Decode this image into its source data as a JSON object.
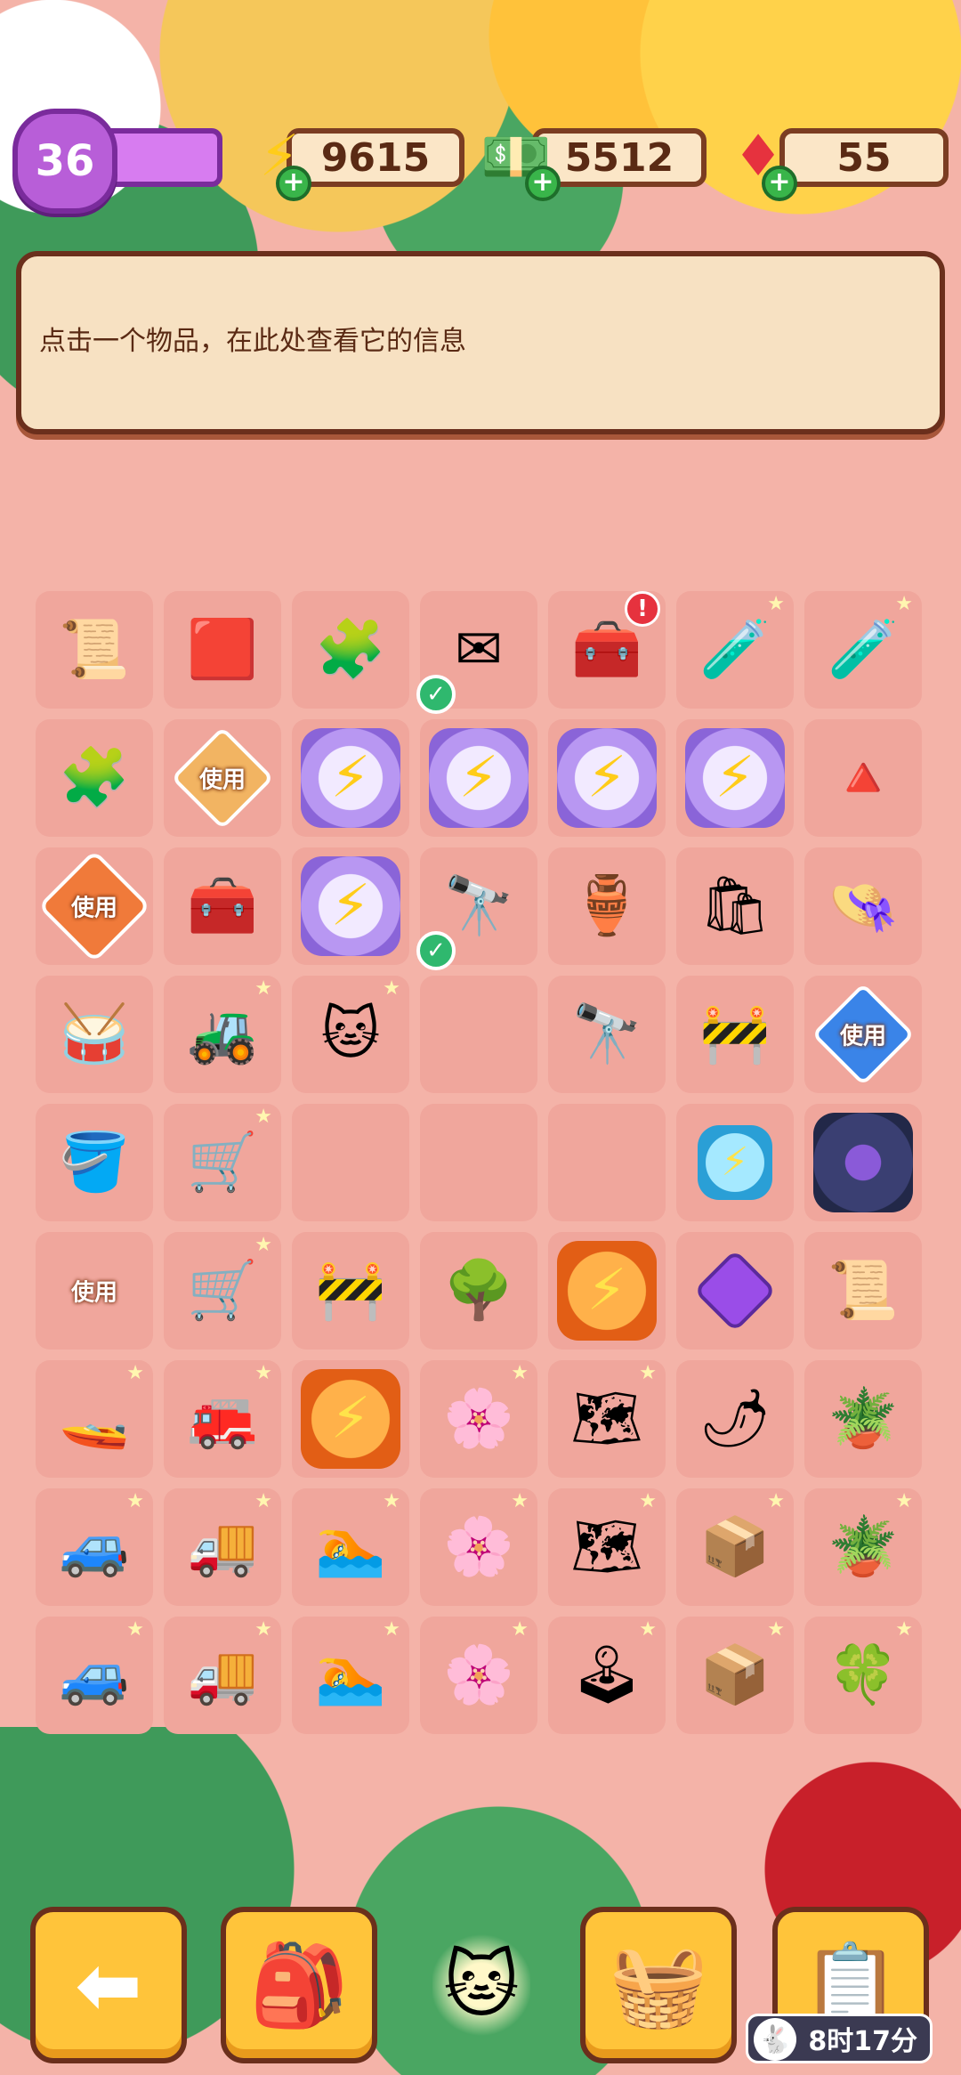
{
  "status": {
    "level": "36",
    "energy": "9615",
    "cash": "5512",
    "gems": "55"
  },
  "info_panel": {
    "text": "点击一个物品，在此处查看它的信息"
  },
  "use_label": "使用",
  "grid": [
    [
      {
        "icon": "reward-poster-icon",
        "glyph": "📜"
      },
      {
        "icon": "red-box-icon",
        "glyph": "🟥"
      },
      {
        "icon": "tape-pieces-icon",
        "glyph": "🧩"
      },
      {
        "icon": "envelope-icon",
        "glyph": "✉",
        "check": true
      },
      {
        "icon": "treasure-chest-icon",
        "glyph": "🧰",
        "alert": true
      },
      {
        "icon": "medical-kit-icon",
        "glyph": "🧪",
        "sparkle": true
      },
      {
        "icon": "medical-kit-icon",
        "glyph": "🧪",
        "sparkle": true
      }
    ],
    [
      {
        "icon": "map-piece-icon",
        "glyph": "🧩"
      },
      {
        "icon": "use-badge-beige-icon",
        "label": true
      },
      {
        "icon": "energy-orb-icon",
        "glyph": "⚡"
      },
      {
        "icon": "energy-orb-icon",
        "glyph": "⚡"
      },
      {
        "icon": "energy-orb-icon",
        "glyph": "⚡"
      },
      {
        "icon": "energy-orb-icon",
        "glyph": "⚡"
      },
      {
        "icon": "cone-stand-icon",
        "glyph": "🔺"
      }
    ],
    [
      {
        "icon": "use-badge-orange-icon",
        "label": true
      },
      {
        "icon": "toolbox-icon",
        "glyph": "🧰"
      },
      {
        "icon": "energy-orb-icon",
        "glyph": "⚡"
      },
      {
        "icon": "binoculars-icon",
        "glyph": "🔭",
        "check": true
      },
      {
        "icon": "clay-pot-icon",
        "glyph": "🏺"
      },
      {
        "icon": "bag-icon",
        "glyph": "🛍"
      },
      {
        "icon": "hat-icon",
        "glyph": "👒"
      }
    ],
    [
      {
        "icon": "drum-icon",
        "glyph": "🥁"
      },
      {
        "icon": "red-machine-icon",
        "glyph": "🚜",
        "sparkle": true
      },
      {
        "icon": "lucky-cat-icon",
        "glyph": "🐱",
        "sparkle": true
      },
      {
        "icon": "empty",
        "glyph": ""
      },
      {
        "icon": "telescope-icon",
        "glyph": "🔭"
      },
      {
        "icon": "barrier-icon",
        "glyph": "🚧"
      },
      {
        "icon": "use-badge-blue-icon",
        "label": true
      }
    ],
    [
      {
        "icon": "bucket-icon",
        "glyph": "🪣"
      },
      {
        "icon": "red-cart-icon",
        "glyph": "🛒",
        "sparkle": true
      },
      {
        "icon": "empty",
        "glyph": ""
      },
      {
        "icon": "empty",
        "glyph": ""
      },
      {
        "icon": "empty",
        "glyph": ""
      },
      {
        "icon": "energy-small-icon",
        "glyph": "⚡"
      },
      {
        "icon": "wheel-icon",
        "glyph": ""
      }
    ],
    [
      {
        "icon": "cone-use-icon",
        "label": true
      },
      {
        "icon": "white-cart-icon",
        "glyph": "🛒",
        "sparkle": true
      },
      {
        "icon": "barrier-small-icon",
        "glyph": "🚧"
      },
      {
        "icon": "bonsai-icon",
        "glyph": "🌳"
      },
      {
        "icon": "energy-orange-icon",
        "glyph": "⚡"
      },
      {
        "icon": "purple-gem-icon",
        "glyph": ""
      },
      {
        "icon": "scroll-icon",
        "glyph": "📜"
      }
    ],
    [
      {
        "icon": "jet-ski-icon",
        "glyph": "🚤",
        "sparkle": true
      },
      {
        "icon": "red-vehicle-icon",
        "glyph": "🚒",
        "sparkle": true
      },
      {
        "icon": "energy-orange-icon",
        "glyph": "⚡"
      },
      {
        "icon": "blossom-tree-icon",
        "glyph": "🌸",
        "sparkle": true
      },
      {
        "icon": "map-board-icon",
        "glyph": "🗺",
        "sparkle": true
      },
      {
        "icon": "cone-chili-icon",
        "glyph": "🌶"
      },
      {
        "icon": "flower-pot-icon",
        "glyph": "🪴"
      }
    ],
    [
      {
        "icon": "purple-car-icon",
        "glyph": "🚙",
        "sparkle": true
      },
      {
        "icon": "red-truck-icon",
        "glyph": "🚚",
        "sparkle": true
      },
      {
        "icon": "pool-icon",
        "glyph": "🏊",
        "sparkle": true
      },
      {
        "icon": "blossom-tree-icon",
        "glyph": "🌸",
        "sparkle": true
      },
      {
        "icon": "map-board-icon",
        "glyph": "🗺",
        "sparkle": true
      },
      {
        "icon": "crate-icon",
        "glyph": "📦",
        "sparkle": true
      },
      {
        "icon": "pot-seeds-icon",
        "glyph": "🪴",
        "sparkle": true
      }
    ],
    [
      {
        "icon": "jeep-icon",
        "glyph": "🚙",
        "sparkle": true
      },
      {
        "icon": "red-truck-icon",
        "glyph": "🚚",
        "sparkle": true
      },
      {
        "icon": "pool-icon",
        "glyph": "🏊",
        "sparkle": true
      },
      {
        "icon": "blossom-tree-icon",
        "glyph": "🌸",
        "sparkle": true
      },
      {
        "icon": "arcade-icon",
        "glyph": "🕹",
        "sparkle": true
      },
      {
        "icon": "crate-icon",
        "glyph": "📦",
        "sparkle": true
      },
      {
        "icon": "clover-pot-icon",
        "glyph": "🍀",
        "sparkle": true
      }
    ]
  ],
  "bottom_bar": {
    "timer": "8时17分"
  }
}
